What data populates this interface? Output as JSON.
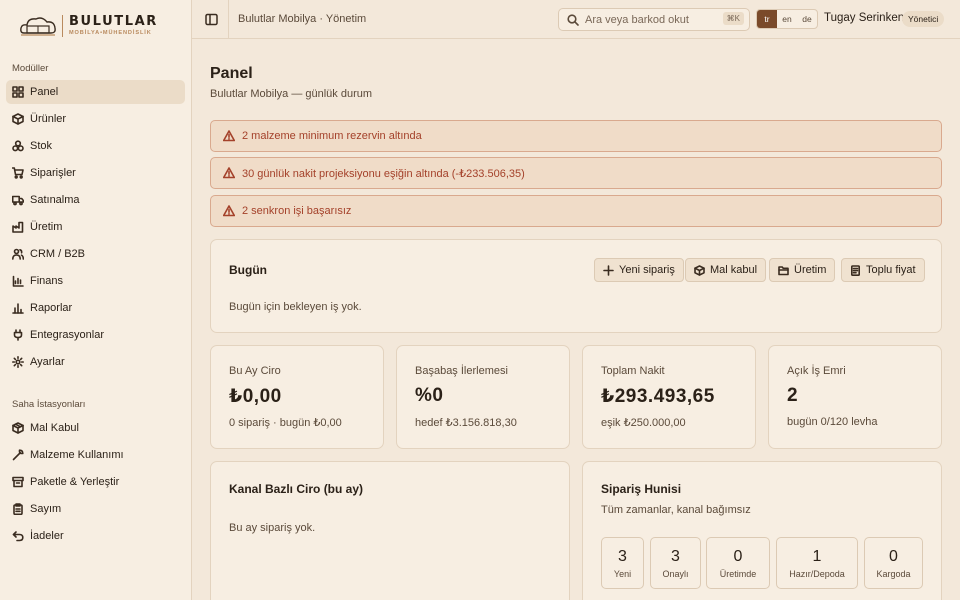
{
  "brand": {
    "title": "BULUTLAR",
    "subtitle": "MOBİLYA•MÜHENDİSLİK"
  },
  "sidebar": {
    "section_modules": "Modüller",
    "items": [
      {
        "label": "Panel",
        "icon": "dashboard-icon",
        "active": true
      },
      {
        "label": "Ürünler",
        "icon": "box-icon"
      },
      {
        "label": "Stok",
        "icon": "boxes-icon"
      },
      {
        "label": "Siparişler",
        "icon": "cart-icon"
      },
      {
        "label": "Satınalma",
        "icon": "truck-icon"
      },
      {
        "label": "Üretim",
        "icon": "factory-icon"
      },
      {
        "label": "CRM / B2B",
        "icon": "users-icon"
      },
      {
        "label": "Finans",
        "icon": "wallet-icon"
      },
      {
        "label": "Raporlar",
        "icon": "bar-chart-icon"
      },
      {
        "label": "Entegrasyonlar",
        "icon": "plug-icon"
      },
      {
        "label": "Ayarlar",
        "icon": "gear-icon"
      }
    ],
    "section_stations": "Saha İstasyonları",
    "stations": [
      {
        "label": "Mal Kabul",
        "icon": "package-icon"
      },
      {
        "label": "Malzeme Kullanımı",
        "icon": "wrench-icon"
      },
      {
        "label": "Paketle & Yerleştir",
        "icon": "archive-icon"
      },
      {
        "label": "Sayım",
        "icon": "clipboard-icon"
      },
      {
        "label": "İadeler",
        "icon": "undo-icon"
      }
    ]
  },
  "topbar": {
    "breadcrumb": "Bulutlar Mobilya · Yönetim",
    "search_placeholder": "Ara veya barkod okut",
    "search_shortcut": "⌘K",
    "languages": [
      "tr",
      "en",
      "de"
    ],
    "active_language": "tr",
    "user_name": "Tugay Serinken",
    "user_role": "Yönetici"
  },
  "page": {
    "title": "Panel",
    "subtitle": "Bulutlar Mobilya — günlük durum"
  },
  "alerts": [
    "2 malzeme minimum rezervin altında",
    "30 günlük nakit projeksiyonu eşiğin altında (-₺233.506,35)",
    "2 senkron işi başarısız"
  ],
  "today": {
    "title": "Bugün",
    "empty": "Bugün için bekleyen iş yok.",
    "actions": [
      "Yeni sipariş",
      "Mal kabul",
      "Üretim",
      "Toplu fiyat"
    ]
  },
  "kpis": [
    {
      "label": "Bu Ay Ciro",
      "value": "₺0,00",
      "sub": "0 sipariş · bugün ₺0,00"
    },
    {
      "label": "Başabaş İlerlemesi",
      "value": "%0",
      "sub": "hedef ₺3.156.818,30"
    },
    {
      "label": "Toplam Nakit",
      "value": "₺293.493,65",
      "sub": "eşik ₺250.000,00"
    },
    {
      "label": "Açık İş Emri",
      "value": "2",
      "sub": "bugün 0/120 levha"
    }
  ],
  "channel": {
    "title": "Kanal Bazlı Ciro (bu ay)",
    "empty": "Bu ay sipariş yok."
  },
  "funnel": {
    "title": "Sipariş Hunisi",
    "subtitle": "Tüm zamanlar, kanal bağımsız",
    "stages": [
      {
        "count": "3",
        "label": "Yeni"
      },
      {
        "count": "3",
        "label": "Onaylı"
      },
      {
        "count": "0",
        "label": "Üretimde"
      },
      {
        "count": "1",
        "label": "Hazır/Depoda"
      },
      {
        "count": "0",
        "label": "Kargoda"
      }
    ]
  }
}
